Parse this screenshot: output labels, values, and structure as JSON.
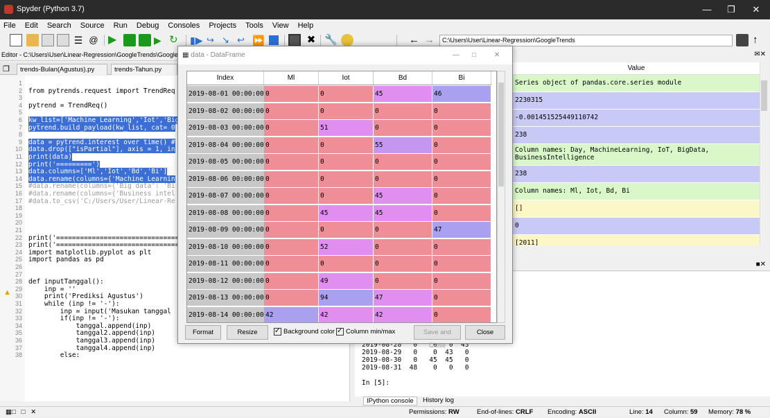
{
  "window": {
    "title": "Spyder (Python 3.7)"
  },
  "menu": [
    "File",
    "Edit",
    "Search",
    "Source",
    "Run",
    "Debug",
    "Consoles",
    "Projects",
    "Tools",
    "View",
    "Help"
  ],
  "toolbar": {
    "path": "C:\\Users\\User\\Linear-Regression\\GoogleTrends"
  },
  "editor": {
    "title": "Editor - C:\\Users\\User\\Linear-Regression\\GoogleTrends\\Google",
    "tabs": [
      "trends-Bulan(Agustus).py",
      "trends-Tahun.py"
    ],
    "lines": [
      {
        "n": "1",
        "t": ""
      },
      {
        "n": "2",
        "t": "from pytrends.request import TrendReq"
      },
      {
        "n": "3",
        "t": ""
      },
      {
        "n": "4",
        "t": "pytrend = TrendReq()"
      },
      {
        "n": "5",
        "t": ""
      },
      {
        "n": "6",
        "t": "kw_list=['Machine Learning','Iot','Big"
      },
      {
        "n": "7",
        "t": "pytrend.build_payload(kw_list, cat= 0"
      },
      {
        "n": "8",
        "t": ""
      },
      {
        "n": "9",
        "t": "data = pytrend.interest_over_time() #"
      },
      {
        "n": "10",
        "t": "data.drop([\"isPartial\"], axis = 1, in"
      },
      {
        "n": "11",
        "t": "print(data)"
      },
      {
        "n": "12",
        "t": "print('=========')"
      },
      {
        "n": "13",
        "t": "data.columns=['Ml','Iot','Bd','Bi']"
      },
      {
        "n": "14",
        "t": "data.rename(columns={'Machine Learnin"
      },
      {
        "n": "15",
        "t": "#data.rename(columns={'Big data': 'Bi"
      },
      {
        "n": "16",
        "t": "#data.rename(columns={'Business intel"
      },
      {
        "n": "17",
        "t": "#data.to_csv('C:/Users/User/Linear-Re"
      },
      {
        "n": "18",
        "t": ""
      },
      {
        "n": "19",
        "t": ""
      },
      {
        "n": "20",
        "t": ""
      },
      {
        "n": "21",
        "t": ""
      },
      {
        "n": "22",
        "t": "print('================================"
      },
      {
        "n": "23",
        "t": "print('================================"
      },
      {
        "n": "24",
        "t": "import matplotlib.pyplot as plt"
      },
      {
        "n": "25",
        "t": "import pandas as pd"
      },
      {
        "n": "26",
        "t": ""
      },
      {
        "n": "27",
        "t": ""
      },
      {
        "n": "28",
        "t": "def inputTanggal():"
      },
      {
        "n": "29",
        "t": "    inp = ''"
      },
      {
        "n": "30",
        "t": "    print('Prediksi Agustus')"
      },
      {
        "n": "31",
        "t": "    while (inp != '-'):"
      },
      {
        "n": "32",
        "t": "        inp = input('Masukan tanggal"
      },
      {
        "n": "33",
        "t": "        if(inp != '-'):"
      },
      {
        "n": "34",
        "t": "            tanggal.append(inp)"
      },
      {
        "n": "35",
        "t": "            tanggal2.append(inp)"
      },
      {
        "n": "36",
        "t": "            tanggal3.append(inp)"
      },
      {
        "n": "37",
        "t": "            tanggal4.append(inp)"
      },
      {
        "n": "38",
        "t": "        else:"
      }
    ]
  },
  "variables": {
    "header": "Value",
    "rows": [
      {
        "v": "Series object of pandas.core.series module",
        "c": "#d9f7c8"
      },
      {
        "v": "2230315",
        "c": "#c9c9f5"
      },
      {
        "v": "-0.001451525449110742",
        "c": "#c9c9f5"
      },
      {
        "v": "238",
        "c": "#c9c9f5"
      },
      {
        "v": "Column names: Day, MachineLearning, IoT, BigData, BusinessIntelligence",
        "c": "#d9f7c8"
      },
      {
        "v": "238",
        "c": "#c9c9f5"
      },
      {
        "v": "Column names: Ml, Iot, Bd, Bi",
        "c": "#d9f7c8"
      },
      {
        "v": "[]",
        "c": "#fbf7c6"
      },
      {
        "v": "0",
        "c": "#c9c9f5"
      },
      {
        "v": "[2011]",
        "c": "#fbf7c6"
      }
    ]
  },
  "console": {
    "lines": [
      "2019-08-28   0    0   0  43",
      "2019-08-29   0    0  43   0",
      "2019-08-30   0   45  45   0",
      "2019-08-31  48    0   0   0",
      "",
      "In [5]:"
    ],
    "tabs": [
      "IPython console",
      "History log"
    ]
  },
  "dialog": {
    "title": "data - DataFrame",
    "columns": [
      "Index",
      "Ml",
      "Iot",
      "Bd",
      "Bi"
    ],
    "rows": [
      [
        "2019-08-01 00:00:00",
        "0",
        "0",
        "45",
        "46"
      ],
      [
        "2019-08-02 00:00:00",
        "0",
        "0",
        "0",
        "0"
      ],
      [
        "2019-08-03 00:00:00",
        "0",
        "51",
        "0",
        "0"
      ],
      [
        "2019-08-04 00:00:00",
        "0",
        "0",
        "55",
        "0"
      ],
      [
        "2019-08-05 00:00:00",
        "0",
        "0",
        "0",
        "0"
      ],
      [
        "2019-08-06 00:00:00",
        "0",
        "0",
        "0",
        "0"
      ],
      [
        "2019-08-07 00:00:00",
        "0",
        "0",
        "45",
        "0"
      ],
      [
        "2019-08-08 00:00:00",
        "0",
        "45",
        "45",
        "0"
      ],
      [
        "2019-08-09 00:00:00",
        "0",
        "0",
        "0",
        "47"
      ],
      [
        "2019-08-10 00:00:00",
        "0",
        "52",
        "0",
        "0"
      ],
      [
        "2019-08-11 00:00:00",
        "0",
        "0",
        "0",
        "0"
      ],
      [
        "2019-08-12 00:00:00",
        "0",
        "49",
        "0",
        "0"
      ],
      [
        "2019-08-13 00:00:00",
        "0",
        "94",
        "47",
        "0"
      ],
      [
        "2019-08-14 00:00:00",
        "42",
        "42",
        "42",
        "0"
      ]
    ],
    "buttons": {
      "format": "Format",
      "resize": "Resize",
      "save_close": "Save and Close",
      "close": "Close"
    },
    "checks": {
      "bg": "Background color",
      "minmax": "Column min/max"
    }
  },
  "status": {
    "permissions_label": "Permissions:",
    "permissions": "RW",
    "eol_label": "End-of-lines:",
    "eol": "CRLF",
    "enc_label": "Encoding:",
    "enc": "ASCII",
    "line_label": "Line:",
    "line": "14",
    "col_label": "Column:",
    "col": "59",
    "mem_label": "Memory:",
    "mem": "78 %"
  }
}
